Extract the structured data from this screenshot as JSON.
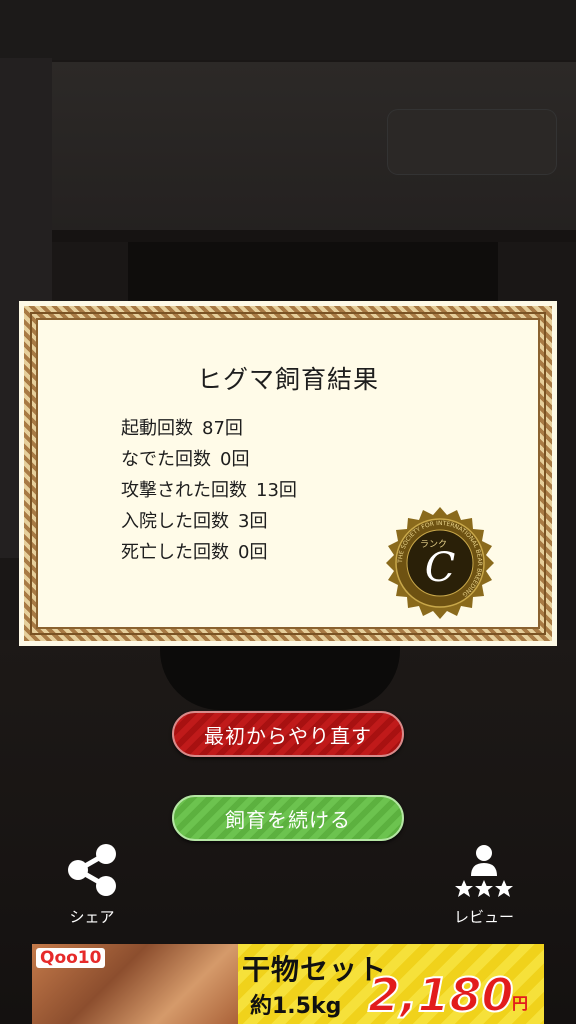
{
  "certificate": {
    "title": "ヒグマ飼育結果",
    "stats": [
      {
        "label": "起動回数",
        "value": "87回"
      },
      {
        "label": "なでた回数",
        "value": "0回"
      },
      {
        "label": "攻撃された回数",
        "value": "13回"
      },
      {
        "label": "入院した回数",
        "value": "3回"
      },
      {
        "label": "死亡した回数",
        "value": "0回"
      }
    ],
    "seal": {
      "rank": "C",
      "ring_text": "THE SOCIETY FOR INTERNATIONAL BEAR BREEDING",
      "label_kana": "ランク",
      "color": "#8a6a1c"
    }
  },
  "buttons": {
    "restart": "最初からやり直す",
    "continue": "飼育を続ける"
  },
  "actions": {
    "share": "シェア",
    "review": "レビュー"
  },
  "ad": {
    "logo": "Qoo10",
    "product": "干物セット",
    "weight": "約1.5kg",
    "price": "2,180",
    "currency": "円"
  },
  "colors": {
    "restart_button": "#b71616",
    "continue_button": "#63b947",
    "certificate_bg": "#fffbe8",
    "frame": "#a87a44"
  }
}
